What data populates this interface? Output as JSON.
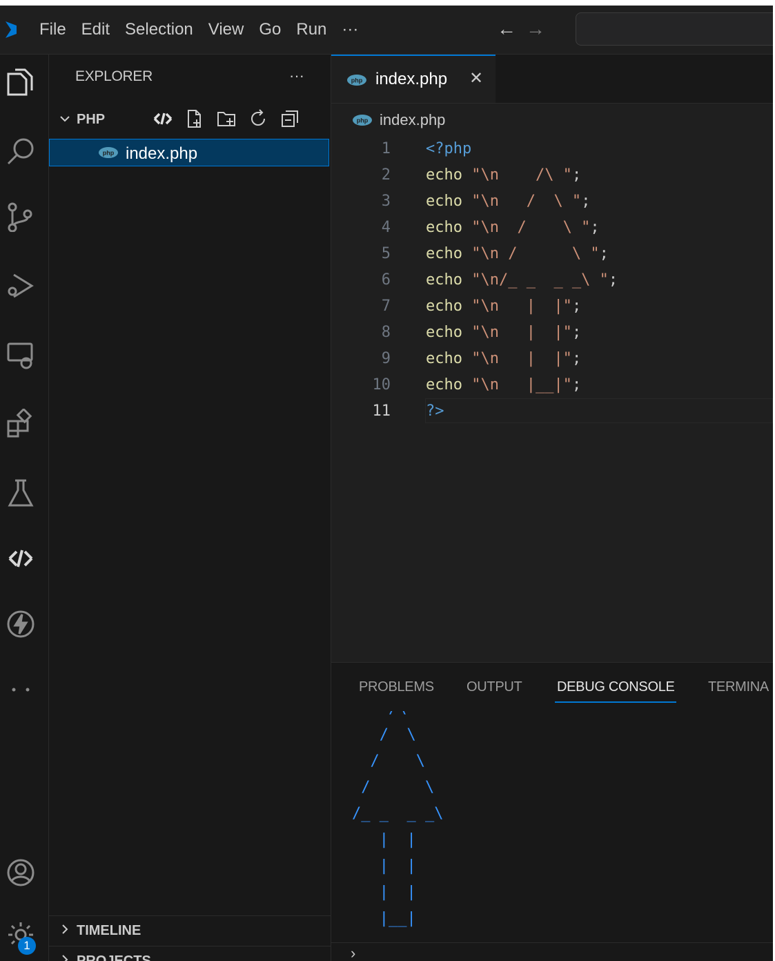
{
  "menu": [
    "File",
    "Edit",
    "Selection",
    "View",
    "Go",
    "Run",
    "···"
  ],
  "nav": {
    "back": "←",
    "forward": "→"
  },
  "sidebar": {
    "title": "EXPLORER",
    "more": "···",
    "folder": "PHP",
    "file": "index.php",
    "sections": [
      "TIMELINE",
      "PROJECTS"
    ]
  },
  "activity": {
    "icons": [
      "explorer-icon",
      "search-icon",
      "source-control-icon",
      "run-debug-icon",
      "remote-explorer-icon",
      "extensions-icon",
      "testing-icon",
      "live-share-icon",
      "thunder-icon",
      "more-icon",
      "account-icon",
      "settings-icon"
    ],
    "settings_badge": "1"
  },
  "editor": {
    "tab_label": "index.php",
    "tab_close": "✕",
    "breadcrumb": "index.php",
    "active_line": 11,
    "lines": [
      {
        "n": "1",
        "code": "<?php"
      },
      {
        "n": "2",
        "code": "echo \"\\n    /\\ \";"
      },
      {
        "n": "3",
        "code": "echo \"\\n   /  \\ \";"
      },
      {
        "n": "4",
        "code": "echo \"\\n  /    \\ \";"
      },
      {
        "n": "5",
        "code": "echo \"\\n /      \\ \";"
      },
      {
        "n": "6",
        "code": "echo \"\\n/_ _  _ _\\ \";"
      },
      {
        "n": "7",
        "code": "echo \"\\n   |  |\";"
      },
      {
        "n": "8",
        "code": "echo \"\\n   |  |\";"
      },
      {
        "n": "9",
        "code": "echo \"\\n   |  |\";"
      },
      {
        "n": "10",
        "code": "echo \"\\n   |__|\";"
      },
      {
        "n": "11",
        "code": "?>"
      }
    ]
  },
  "panel": {
    "tabs": [
      "PROBLEMS",
      "OUTPUT",
      "DEBUG CONSOLE",
      "TERMINA"
    ],
    "active_tab": "DEBUG CONSOLE",
    "output": "    /\\ \n   /  \\ \n  /    \\ \n /      \\ \n/_ _  _ _\\ \n   |  |\n   |  |\n   |  |\n   |__|",
    "prompt": "›"
  },
  "colors": {
    "accent": "#0078d4",
    "php_icon": "#519aba",
    "console_text": "#3794ff"
  }
}
